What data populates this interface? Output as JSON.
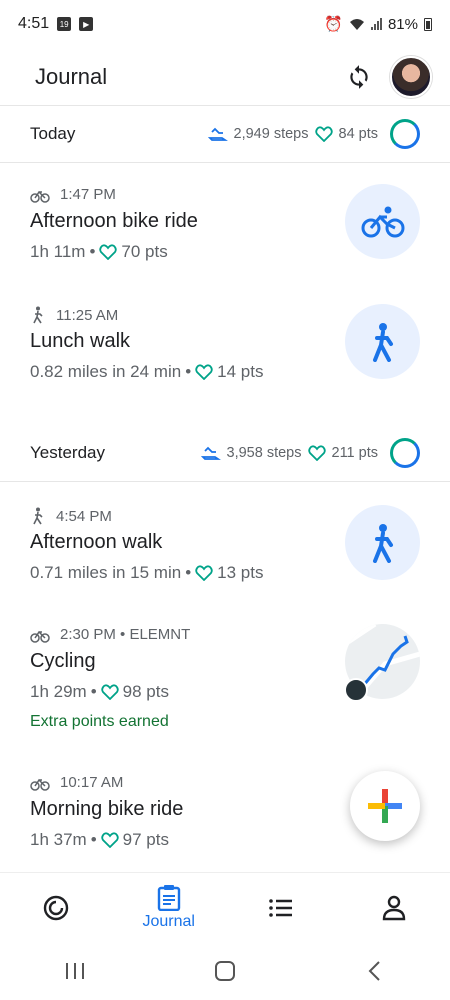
{
  "status_bar": {
    "time": "4:51",
    "battery": "81%"
  },
  "app_bar": {
    "title": "Journal"
  },
  "days": [
    {
      "title": "Today",
      "steps": "2,949 steps",
      "pts": "84 pts"
    },
    {
      "title": "Yesterday",
      "steps": "3,958 steps",
      "pts": "211 pts"
    }
  ],
  "activities": [
    {
      "icon": "bike-icon",
      "time": "1:47 PM",
      "title": "Afternoon bike ride",
      "detail": "1h 11m",
      "pts": "70 pts"
    },
    {
      "icon": "walk-icon",
      "time": "11:25 AM",
      "title": "Lunch walk",
      "detail": "0.82 miles in 24 min",
      "pts": "14 pts"
    },
    {
      "icon": "walk-icon",
      "time": "4:54 PM",
      "title": "Afternoon walk",
      "detail": "0.71 miles in 15 min",
      "pts": "13 pts"
    },
    {
      "icon": "bike-icon",
      "time": "2:30 PM • ELEMNT",
      "title": "Cycling",
      "detail": "1h 29m",
      "pts": "98 pts",
      "extra": "Extra points earned"
    },
    {
      "icon": "bike-icon",
      "time": "10:17 AM",
      "title": "Morning bike ride",
      "detail": "1h 37m",
      "pts": "97 pts"
    }
  ],
  "nav": {
    "journal": "Journal"
  },
  "colors": {
    "accent": "#1a73e8",
    "teal": "#00a389",
    "green": "#137333"
  }
}
